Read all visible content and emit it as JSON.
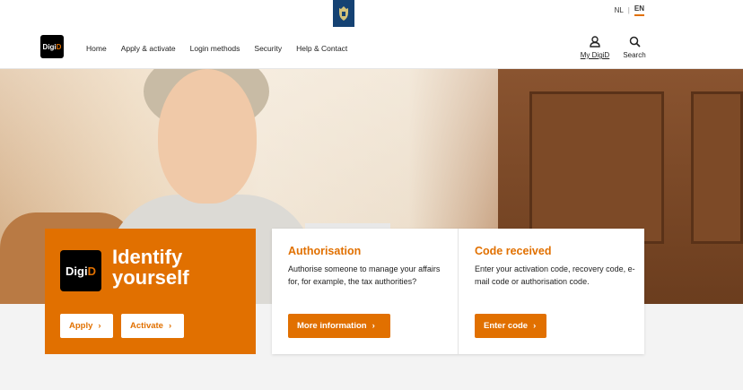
{
  "language": {
    "nl": "NL",
    "separator": "|",
    "en": "EN"
  },
  "logo": {
    "digi": "Digi",
    "d": "D"
  },
  "nav": [
    "Home",
    "Apply & activate",
    "Login methods",
    "Security",
    "Help & Contact"
  ],
  "header_actions": {
    "my_digid": "My DigiD",
    "search": "Search"
  },
  "hero_card": {
    "title": "Identify yourself",
    "apply_label": "Apply",
    "activate_label": "Activate"
  },
  "authorisation": {
    "title": "Authorisation",
    "text": "Authorise someone to manage your affairs for, for example, the tax authorities?",
    "button": "More information"
  },
  "code_received": {
    "title": "Code received",
    "text": "Enter your activation code, recovery code, e-mail code or authorisation code.",
    "button": "Enter code"
  },
  "colors": {
    "accent": "#e17000",
    "crest": "#154273"
  },
  "icons": {
    "chevron": "›"
  }
}
